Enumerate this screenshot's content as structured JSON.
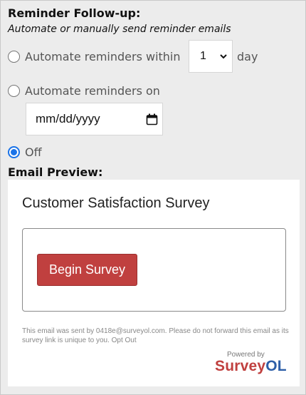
{
  "reminder": {
    "title": "Reminder Follow-up:",
    "subtitle": "Automate or manually send reminder emails",
    "option_within_label": "Automate reminders within",
    "within_value": "1",
    "within_unit": "day",
    "option_on_label": "Automate reminders on",
    "date_placeholder": "mm/dd/yyyy",
    "option_off_label": "Off",
    "selected": "off"
  },
  "preview": {
    "label": "Email Preview:",
    "survey_title": "Customer Satisfaction Survey",
    "button_label": "Begin Survey",
    "disclaimer": "This email was sent by 0418e@surveyol.com. Please do not forward this email as its survey link is unique to you. Opt Out",
    "powered_by": "Powered by",
    "brand_part1": "Survey",
    "brand_part2": "OL"
  },
  "colors": {
    "accent": "#1a73e8",
    "button": "#c0403f",
    "brand_red": "#c0403f",
    "brand_blue": "#2d5fa8"
  },
  "icons": [
    "chevron-down-icon",
    "calendar-icon"
  ]
}
